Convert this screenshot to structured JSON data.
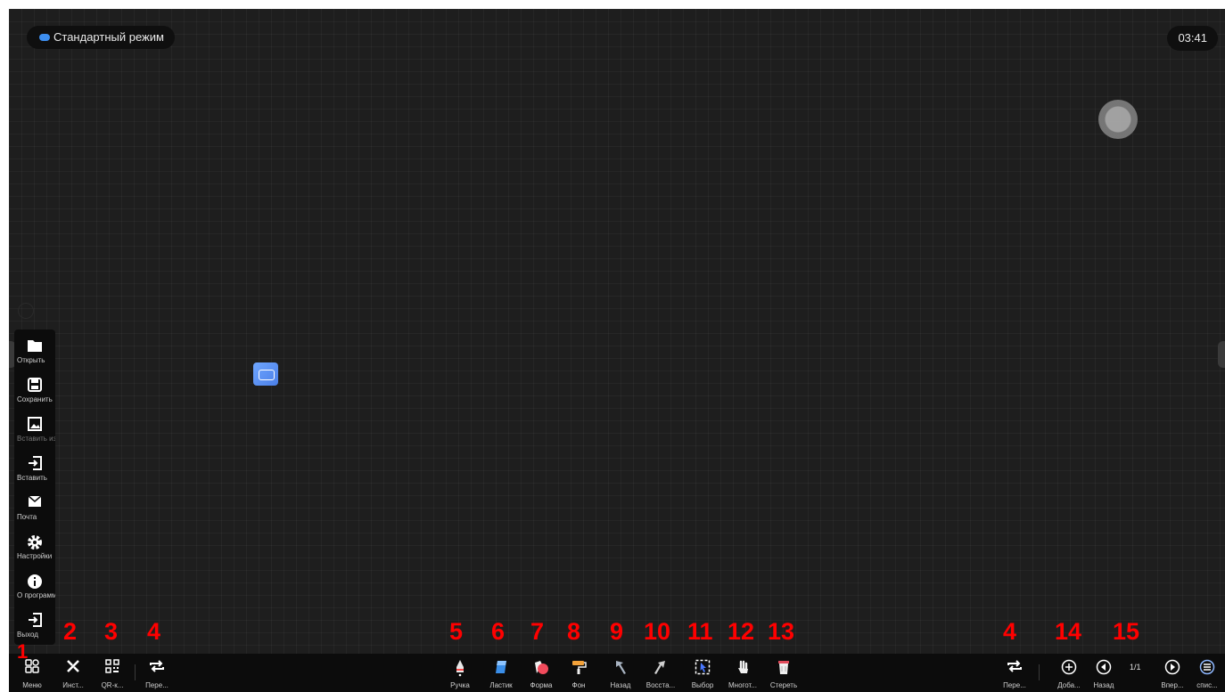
{
  "topbar": {
    "mode_label": "Стандартный режим",
    "clock": "03:41"
  },
  "sidebar": {
    "items": [
      {
        "icon": "folder-icon",
        "label": "Открыть"
      },
      {
        "icon": "save-icon",
        "label": "Сохранить"
      },
      {
        "icon": "image-icon",
        "label": "Вставить изображение"
      },
      {
        "icon": "insert-icon",
        "label": "Вставить"
      },
      {
        "icon": "mail-icon",
        "label": "Почта"
      },
      {
        "icon": "gear-icon",
        "label": "Настройки"
      },
      {
        "icon": "info-icon",
        "label": "О программе"
      },
      {
        "icon": "exit-icon",
        "label": "Выход"
      }
    ]
  },
  "bottombar": {
    "left": [
      {
        "icon": "grid-icon",
        "label": "Меню"
      },
      {
        "icon": "tools-icon",
        "label": "Инст..."
      },
      {
        "icon": "qr-icon",
        "label": "QR-к..."
      },
      {
        "icon": "swap-icon",
        "label": "Пере..."
      }
    ],
    "center": [
      {
        "icon": "pen-icon",
        "label": "Ручка"
      },
      {
        "icon": "eraser-icon",
        "label": "Ластик"
      },
      {
        "icon": "shape-icon",
        "label": "Форма"
      },
      {
        "icon": "background-icon",
        "label": "Фон"
      },
      {
        "icon": "undo-icon",
        "label": "Назад"
      },
      {
        "icon": "redo-icon",
        "label": "Восста..."
      },
      {
        "icon": "select-icon",
        "label": "Выбор"
      },
      {
        "icon": "multitouch-icon",
        "label": "Многот..."
      },
      {
        "icon": "trash-icon",
        "label": "Стереть"
      }
    ],
    "right": [
      {
        "icon": "swap-icon",
        "label": "Пере..."
      },
      {
        "icon": "add-page-icon",
        "label": "Доба..."
      },
      {
        "icon": "prev-page-icon",
        "label": "Назад"
      },
      {
        "icon": "next-page-icon",
        "label": "Впер..."
      },
      {
        "icon": "page-list-icon",
        "label": "спис..."
      }
    ],
    "page_indicator": "1/1"
  },
  "annotations": [
    "1",
    "2",
    "3",
    "4",
    "5",
    "6",
    "7",
    "8",
    "9",
    "10",
    "11",
    "12",
    "13",
    "4",
    "14",
    "15"
  ],
  "colors": {
    "canvas": "#1e1e1e",
    "bar": "#0c0c0c",
    "accent": "#3d8ef0",
    "annotation": "#ff0000"
  }
}
